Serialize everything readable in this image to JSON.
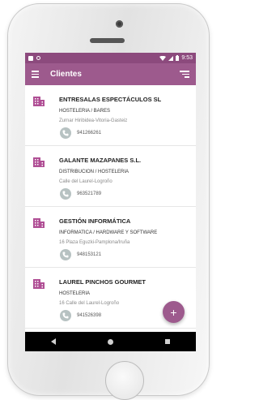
{
  "status_bar": {
    "time": "9:53",
    "colors": {
      "status": "#8c4a7d"
    }
  },
  "app_bar": {
    "title": "Clientes",
    "color": "#9d5a8d"
  },
  "clients": [
    {
      "name": "ENTRESALAS ESPECTÁCULOS SL",
      "category": "HOSTELERIA / BARES",
      "address": "Zurnar Hiribidea-Vitoria-Gasteiz",
      "phone": "941266261"
    },
    {
      "name": "GALANTE MAZAPANES S.L.",
      "category": "DISTRIBUCION / HOSTELERIA",
      "address": "Calle del Laurel-Logroño",
      "phone": "963521789"
    },
    {
      "name": "GESTIÓN INFORMÁTICA",
      "category": "INFORMATICA / HARDWARE Y SOFTWARE",
      "address": "16 Plaza Eguzki-Pamplona/Iruña",
      "phone": "948153121"
    },
    {
      "name": "LAUREL PINCHOS GOURMET",
      "category": "HOSTELERIA",
      "address": "16 Calle del Laurel-Logroño",
      "phone": "941526398"
    }
  ],
  "fab": {
    "icon": "plus-icon",
    "label": "+"
  },
  "icons": {
    "client": "building-icon",
    "call": "phone-icon"
  }
}
